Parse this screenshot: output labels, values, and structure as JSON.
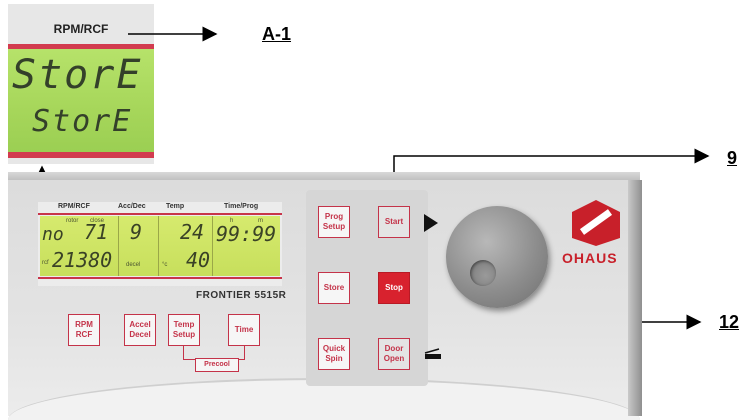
{
  "inset": {
    "title": "RPM/RCF",
    "line1": "StorE",
    "line2": "StorE"
  },
  "annotations": {
    "a1": "A-1",
    "start": "9",
    "store": "12"
  },
  "display": {
    "headers": [
      "RPM/RCF",
      "Acc/Dec",
      "Temp",
      "Time/Prog"
    ],
    "labels": {
      "rotor": "rotor",
      "close": "close",
      "no": "no",
      "rcf": "rcf",
      "decel": "decel",
      "celsius": "°c",
      "h": "h",
      "m": "m"
    },
    "values": {
      "rotor_no": "71",
      "rpm": "21380",
      "accel": "9",
      "decel": "",
      "temp_set": "24",
      "temp_actual": "40",
      "time": "99:99"
    }
  },
  "brand_model": "FRONTIER 5515R",
  "buttons": {
    "rpm_rcf": "RPM\nRCF",
    "accel_decel": "Accel\nDecel",
    "temp_setup": "Temp\nSetup",
    "time": "Time",
    "precool": "Precool",
    "prog_setup": "Prog\nSetup",
    "start": "Start",
    "store": "Store",
    "stop": "Stop",
    "quick_spin": "Quick\nSpin",
    "door_open": "Door\nOpen"
  },
  "logo_text": "OHAUS",
  "colors": {
    "accent_red": "#c43349",
    "stop_red": "#d8222e",
    "lcd_green": "#c7df5c",
    "logo_red": "#c8202a"
  },
  "icons": [
    "play-icon",
    "door-open-icon",
    "ohaus-logo-icon",
    "rotary-knob"
  ]
}
